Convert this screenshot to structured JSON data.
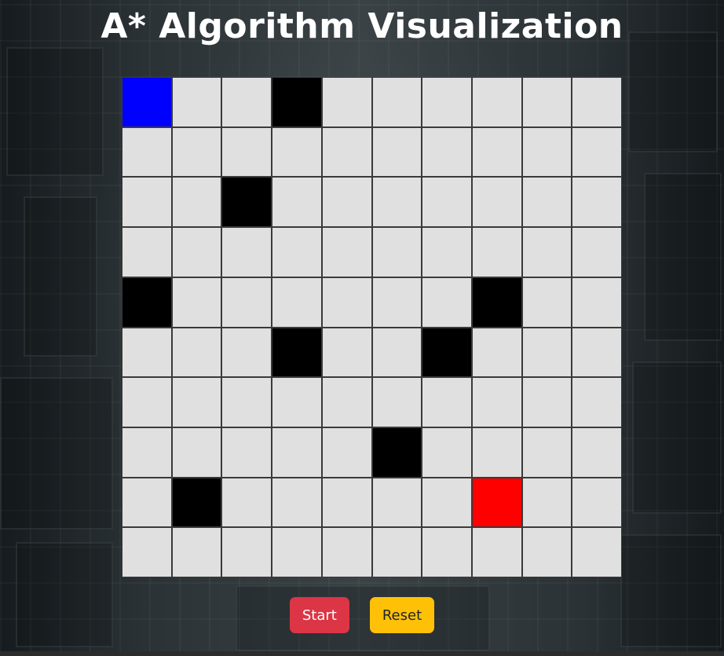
{
  "title": "A* Algorithm Visualization",
  "grid": {
    "rows": 10,
    "cols": 10,
    "cells": [
      [
        "start",
        "empty",
        "empty",
        "wall",
        "empty",
        "empty",
        "empty",
        "empty",
        "empty",
        "empty"
      ],
      [
        "empty",
        "empty",
        "empty",
        "empty",
        "empty",
        "empty",
        "empty",
        "empty",
        "empty",
        "empty"
      ],
      [
        "empty",
        "empty",
        "wall",
        "empty",
        "empty",
        "empty",
        "empty",
        "empty",
        "empty",
        "empty"
      ],
      [
        "empty",
        "empty",
        "empty",
        "empty",
        "empty",
        "empty",
        "empty",
        "empty",
        "empty",
        "empty"
      ],
      [
        "wall",
        "empty",
        "empty",
        "empty",
        "empty",
        "empty",
        "empty",
        "wall",
        "empty",
        "empty"
      ],
      [
        "empty",
        "empty",
        "empty",
        "wall",
        "empty",
        "empty",
        "wall",
        "empty",
        "empty",
        "empty"
      ],
      [
        "empty",
        "empty",
        "empty",
        "empty",
        "empty",
        "empty",
        "empty",
        "empty",
        "empty",
        "empty"
      ],
      [
        "empty",
        "empty",
        "empty",
        "empty",
        "empty",
        "wall",
        "empty",
        "empty",
        "empty",
        "empty"
      ],
      [
        "empty",
        "wall",
        "empty",
        "empty",
        "empty",
        "empty",
        "empty",
        "end",
        "empty",
        "empty"
      ],
      [
        "empty",
        "empty",
        "empty",
        "empty",
        "empty",
        "empty",
        "empty",
        "empty",
        "empty",
        "empty"
      ]
    ]
  },
  "colors": {
    "empty": "#e0e0e0",
    "wall": "#000000",
    "start": "#0000ff",
    "end": "#ff0000",
    "start_button": "#dc3545",
    "reset_button": "#ffc107"
  },
  "controls": {
    "start_label": "Start",
    "reset_label": "Reset"
  }
}
